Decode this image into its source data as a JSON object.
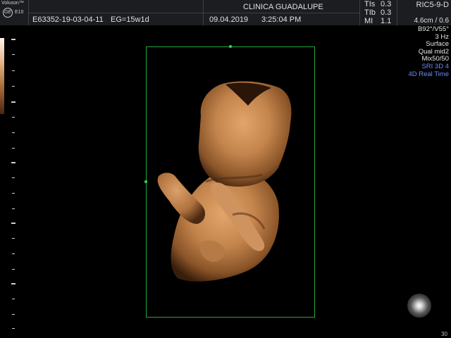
{
  "header": {
    "brand": "Voluson™",
    "model": "E10",
    "logo_text": "GE",
    "patient_id": "E63352-19-03-04-11",
    "ga": "EG=15w1d",
    "clinic": "CLINICA GUADALUPE",
    "date": "09.04.2019",
    "time": "3:25:04 PM",
    "tis_label": "TIs",
    "tis_value": "0.3",
    "tib_label": "TIb",
    "tib_value": "0.3",
    "mi_label": "MI",
    "mi_value": "1.1",
    "probe": "RIC5-9-D",
    "depth": "4.6cm / 0.6"
  },
  "params": {
    "angle": "B92°/V55°",
    "rate": "3 Hz",
    "render": "Surface",
    "quality": "Qual mid2",
    "mix": "Mix50/50",
    "sri": "SRI 3D 4",
    "mode": "4D Real Time"
  },
  "colors": {
    "roi": "#1fa83a",
    "mode_text": "#6b8cff",
    "fetus_skin": "#c98a52"
  },
  "corner_text": "30"
}
